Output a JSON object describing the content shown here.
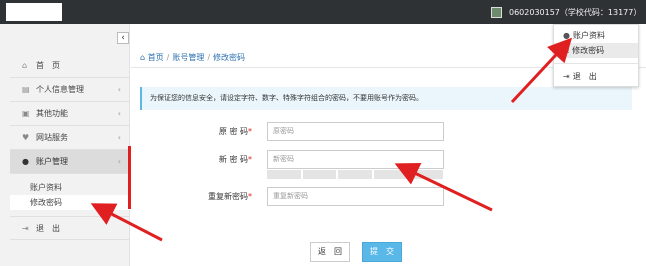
{
  "header": {
    "user_text": "0602030157（学校代码：13177）",
    "caret": "▾"
  },
  "sidebar": {
    "collapse_glyph": "‹",
    "items": [
      {
        "label": "首　页",
        "icon": "home-icon"
      },
      {
        "label": "个人信息管理",
        "icon": "list-icon"
      },
      {
        "label": "其他功能",
        "icon": "folder-icon"
      },
      {
        "label": "网站服务",
        "icon": "heart-icon"
      },
      {
        "label": "账户管理",
        "icon": "user-icon"
      },
      {
        "label": "退　出",
        "icon": "logout-icon"
      }
    ],
    "submenu": [
      "账户资料",
      "修改密码"
    ]
  },
  "breadcrumb": {
    "home": "首页",
    "section": "账号管理",
    "page": "修改密码",
    "sep": "/"
  },
  "notice": "为保证您的信息安全，请设定字符、数字、特殊字符组合的密码，不要用账号作为密码。",
  "form": {
    "old_label": "原 密 码",
    "old_placeholder": "原密码",
    "new_label": "新 密 码",
    "new_placeholder": "新密码",
    "confirm_label": "重复新密码",
    "confirm_placeholder": "重复新密码",
    "required_mark": "*"
  },
  "buttons": {
    "back": "返　回",
    "submit": "提　交"
  },
  "dropdown": {
    "profile": "账户资料",
    "change_password": "修改密码",
    "logout": "退　出"
  },
  "colors": {
    "accent": "#5ab8e8",
    "annotation": "#e02020",
    "topbar": "#2e3234"
  }
}
